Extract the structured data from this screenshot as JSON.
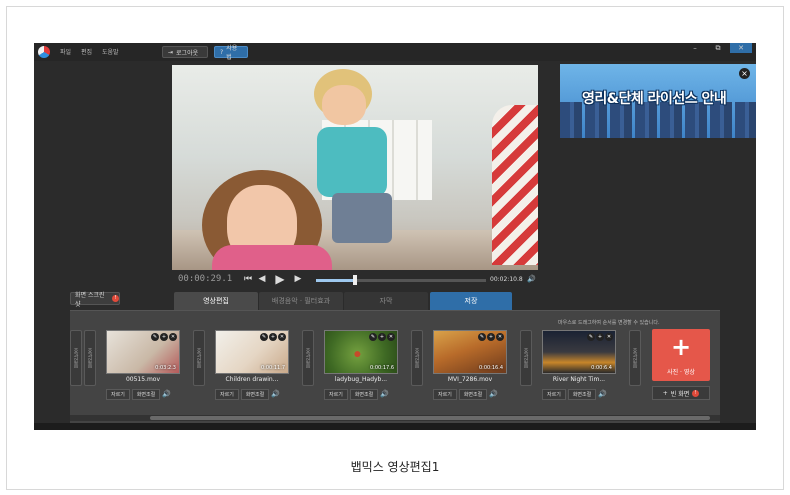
{
  "menu": {
    "file": "파일",
    "edit": "편집",
    "help": "도움말"
  },
  "toolbar": {
    "login": "로그아웃",
    "guide": "사용법"
  },
  "ad": {
    "text": "영리&단체 라이선스 안내",
    "close": "×"
  },
  "player": {
    "time_current": "00:00:29.1",
    "time_end": "00:02:10.8",
    "progress": 0.23
  },
  "tabs": {
    "screenshot": "화면 스크린샷",
    "edit": "영상편집",
    "bgm": "배경음악 · 필터효과",
    "subtitle": "자막",
    "save": "저장"
  },
  "hint": "마우스로 드래그하여 순서를 변경할 수 있습니다.",
  "transition_label": "효과없음",
  "clips": [
    {
      "name": "00515.mov",
      "duration": "0:03:2.3",
      "cut": "자르기",
      "adjust": "화면조절"
    },
    {
      "name": "Children drawin...",
      "duration": "0:00:11.7",
      "cut": "자르기",
      "adjust": "화면조절"
    },
    {
      "name": "ladybug_Hadyb...",
      "duration": "0:00:17.6",
      "cut": "자르기",
      "adjust": "화면조절"
    },
    {
      "name": "MVI_7286.mov",
      "duration": "0:00:16.4",
      "cut": "자르기",
      "adjust": "화면조절"
    },
    {
      "name": "River Night Tim...",
      "duration": "0:00:6.4",
      "cut": "자르기",
      "adjust": "화면조절"
    }
  ],
  "add_media": {
    "label": "사진 · 영상",
    "blank": "빈 화면"
  },
  "caption": "뱁믹스 영상편집1",
  "colors": {
    "accent_blue": "#2f6ea8",
    "accent_red": "#e5574a",
    "panel": "#444444"
  }
}
